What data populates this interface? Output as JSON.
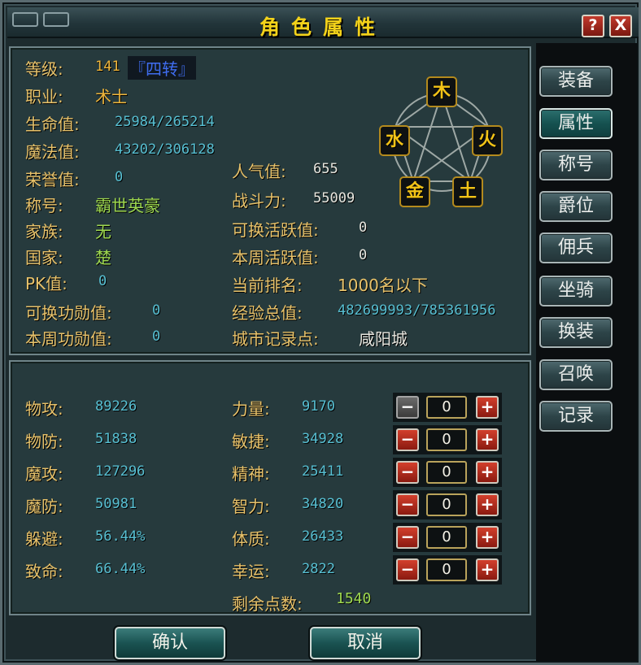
{
  "title": "角色属性",
  "titlebar": {
    "help_label": "?",
    "close_label": "X"
  },
  "tabs": [
    "装备",
    "属性",
    "称号",
    "爵位",
    "佣兵",
    "坐骑",
    "换装",
    "召唤",
    "记录"
  ],
  "active_tab": "属性",
  "info": {
    "level": {
      "label": "等级:",
      "value": "141",
      "rebirth": "『四转』"
    },
    "job": {
      "label": "职业:",
      "value": "术士"
    },
    "hp": {
      "label": "生命值:",
      "value": "25984/265214"
    },
    "mp": {
      "label": "魔法值:",
      "value": "43202/306128"
    },
    "honor": {
      "label": "荣誉值:",
      "value": "0"
    },
    "title_name": {
      "label": "称号:",
      "value": "霸世英豪"
    },
    "clan": {
      "label": "家族:",
      "value": "无"
    },
    "nation": {
      "label": "国家:",
      "value": "楚"
    },
    "pk": {
      "label": "PK值:",
      "value": "0"
    },
    "merit_exchange": {
      "label": "可换功勋值:",
      "value": "0"
    },
    "merit_week": {
      "label": "本周功勋值:",
      "value": "0"
    },
    "popularity": {
      "label": "人气值:",
      "value": "655"
    },
    "power": {
      "label": "战斗力:",
      "value": "55009"
    },
    "active_exchange": {
      "label": "可换活跃值:",
      "value": "0"
    },
    "active_week": {
      "label": "本周活跃值:",
      "value": "0"
    },
    "ranking": {
      "label": "当前排名:",
      "value": "1000名以下"
    },
    "exp": {
      "label": "经验总值:",
      "value": "482699993/785361956"
    },
    "city": {
      "label": "城市记录点:",
      "value": "咸阳城"
    }
  },
  "elements": {
    "wood": "木",
    "fire": "火",
    "earth": "土",
    "metal": "金",
    "water": "水"
  },
  "combat": [
    {
      "label": "物攻:",
      "value": "89226"
    },
    {
      "label": "物防:",
      "value": "51838"
    },
    {
      "label": "魔攻:",
      "value": "127296"
    },
    {
      "label": "魔防:",
      "value": "50981"
    },
    {
      "label": "躲避:",
      "value": "56.44%"
    },
    {
      "label": "致命:",
      "value": "66.44%"
    }
  ],
  "attributes": [
    {
      "label": "力量:",
      "value": "9170",
      "alloc": "0",
      "minus_disabled": true
    },
    {
      "label": "敏捷:",
      "value": "34928",
      "alloc": "0",
      "minus_disabled": false
    },
    {
      "label": "精神:",
      "value": "25411",
      "alloc": "0",
      "minus_disabled": false
    },
    {
      "label": "智力:",
      "value": "34820",
      "alloc": "0",
      "minus_disabled": false
    },
    {
      "label": "体质:",
      "value": "26433",
      "alloc": "0",
      "minus_disabled": false
    },
    {
      "label": "幸运:",
      "value": "2822",
      "alloc": "0",
      "minus_disabled": false
    }
  ],
  "stepper": {
    "minus_label": "−",
    "plus_label": "+"
  },
  "remaining": {
    "label": "剩余点数:",
    "value": "1540"
  },
  "buttons": {
    "confirm": "确认",
    "cancel": "取消"
  }
}
